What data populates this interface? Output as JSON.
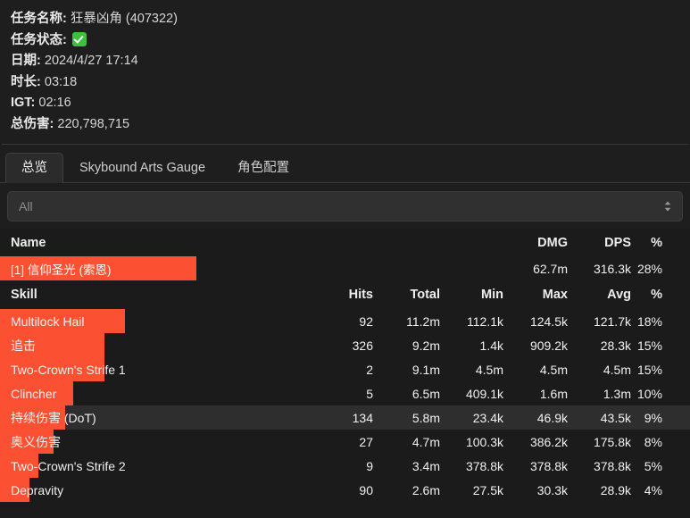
{
  "meta": {
    "quest_name_label": "任务名称:",
    "quest_name_value": "狂暴凶角 (407322)",
    "quest_status_label": "任务状态:",
    "quest_status_icon": "green-check-icon",
    "date_label": "日期:",
    "date_value": "2024/4/27 17:14",
    "duration_label": "时长:",
    "duration_value": "03:18",
    "igt_label": "IGT:",
    "igt_value": "02:16",
    "total_damage_label": "总伤害:",
    "total_damage_value": "220,798,715"
  },
  "tabs": [
    {
      "label": "总览",
      "active": true
    },
    {
      "label": "Skybound Arts Gauge",
      "active": false
    },
    {
      "label": "角色配置",
      "active": false
    }
  ],
  "filter": {
    "value": "All",
    "icon": "chevron-updown-icon"
  },
  "player_table": {
    "headers": {
      "name": "Name",
      "dmg": "DMG",
      "dps": "DPS",
      "pct": "%"
    },
    "rows": [
      {
        "name": "[1] 信仰圣光 (索恩)",
        "dmg": "62.7m",
        "dps": "316.3k",
        "pct": "28%",
        "bar_pct": 28.5
      }
    ]
  },
  "skill_table": {
    "headers": {
      "skill": "Skill",
      "hits": "Hits",
      "total": "Total",
      "min": "Min",
      "max": "Max",
      "avg": "Avg",
      "pct": "%"
    },
    "rows": [
      {
        "name": "Multilock Hail",
        "hits": "92",
        "total": "11.2m",
        "min": "112.1k",
        "max": "124.5k",
        "avg": "121.7k",
        "pct": "18%",
        "bar_pct": 18.1,
        "hover": false
      },
      {
        "name": "追击",
        "hits": "326",
        "total": "9.2m",
        "min": "1.4k",
        "max": "909.2k",
        "avg": "28.3k",
        "pct": "15%",
        "bar_pct": 15.1,
        "hover": false
      },
      {
        "name": "Two-Crown's Strife 1",
        "hits": "2",
        "total": "9.1m",
        "min": "4.5m",
        "max": "4.5m",
        "avg": "4.5m",
        "pct": "15%",
        "bar_pct": 15.1,
        "hover": false
      },
      {
        "name": "Clincher",
        "hits": "5",
        "total": "6.5m",
        "min": "409.1k",
        "max": "1.6m",
        "avg": "1.3m",
        "pct": "10%",
        "bar_pct": 10.6,
        "hover": false
      },
      {
        "name": "持续伤害 (DoT)",
        "hits": "134",
        "total": "5.8m",
        "min": "23.4k",
        "max": "46.9k",
        "avg": "43.5k",
        "pct": "9%",
        "bar_pct": 9.5,
        "hover": true
      },
      {
        "name": "奥义伤害",
        "hits": "27",
        "total": "4.7m",
        "min": "100.3k",
        "max": "386.2k",
        "avg": "175.8k",
        "pct": "8%",
        "bar_pct": 7.8,
        "hover": false
      },
      {
        "name": "Two-Crown's Strife 2",
        "hits": "9",
        "total": "3.4m",
        "min": "378.8k",
        "max": "378.8k",
        "avg": "378.8k",
        "pct": "5%",
        "bar_pct": 5.6,
        "hover": false
      },
      {
        "name": "Depravity",
        "hits": "90",
        "total": "2.6m",
        "min": "27.5k",
        "max": "30.3k",
        "avg": "28.9k",
        "pct": "4%",
        "bar_pct": 4.3,
        "hover": false
      }
    ]
  },
  "colors": {
    "bar": "#fb5032",
    "background": "#1e1e1e",
    "table_background": "#1b1b1b",
    "hover_row": "#2e2e2e",
    "status_green": "#3dc13d"
  }
}
